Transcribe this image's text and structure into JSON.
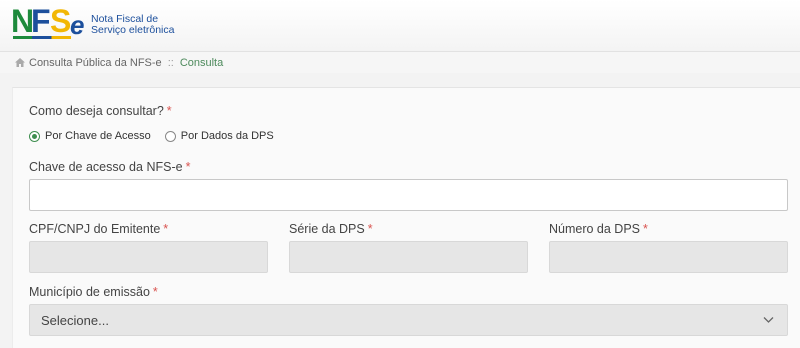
{
  "header": {
    "logo_letters": {
      "n": "N",
      "f": "F",
      "s": "S",
      "e": "e"
    },
    "logo_text_line1": "Nota Fiscal de",
    "logo_text_line2": "Serviço eletrônica",
    "brand_colors": {
      "green": "#1d8a3c",
      "blue": "#1c4f9c",
      "yellow": "#f2b705"
    }
  },
  "breadcrumb": {
    "home_icon": "home-icon",
    "parent": "Consulta Pública da NFS-e",
    "separator": "::",
    "current": "Consulta"
  },
  "form": {
    "question_label": "Como deseja consultar?",
    "required_mark": "*",
    "radio_options": [
      {
        "label": "Por Chave de Acesso",
        "checked": true
      },
      {
        "label": "Por Dados da DPS",
        "checked": false
      }
    ],
    "chave_label": "Chave de acesso da NFS-e",
    "chave_value": "",
    "cpf_label": "CPF/CNPJ do Emitente",
    "serie_label": "Série da DPS",
    "numero_label": "Número da DPS",
    "municipio_label": "Município de emissão",
    "municipio_selected": "Selecione...",
    "accent_color": "#3e8e4f",
    "required_color": "#d9534f"
  }
}
